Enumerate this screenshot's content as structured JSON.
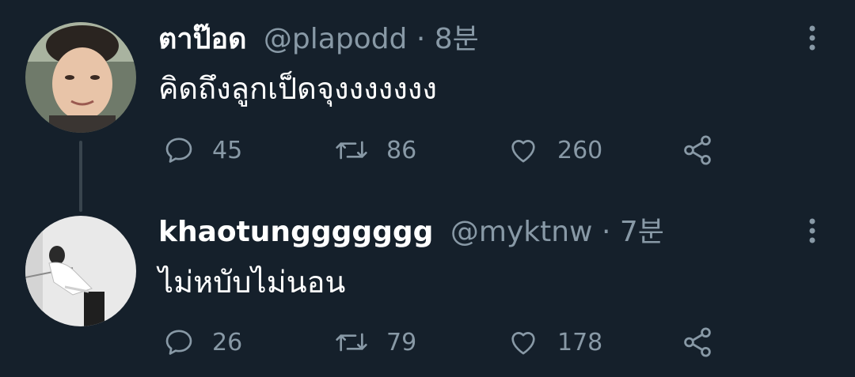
{
  "tweets": [
    {
      "display_name": "ตาป๊อด",
      "handle": "@plapodd",
      "separator": "·",
      "time": "8분",
      "text": "คิดถึงลูกเป็ดจุงงงงงงง",
      "replies": "45",
      "retweets": "86",
      "likes": "260",
      "avatar_icon": "avatar-photo"
    },
    {
      "display_name": "khaotunggggggg",
      "handle": "@myktnw",
      "separator": "·",
      "time": "7분",
      "text": "ไม่หบับไม่นอน",
      "replies": "26",
      "retweets": "79",
      "likes": "178",
      "avatar_icon": "avatar-photo"
    }
  ],
  "icons": {
    "reply": "speech-bubble-icon",
    "retweet": "retweet-icon",
    "like": "heart-icon",
    "share": "share-icon",
    "more": "vertical-dots-icon"
  },
  "colors": {
    "background": "#15202b",
    "primary_text": "#ffffff",
    "secondary_text": "#8899a6",
    "thread_line": "#38444d"
  }
}
